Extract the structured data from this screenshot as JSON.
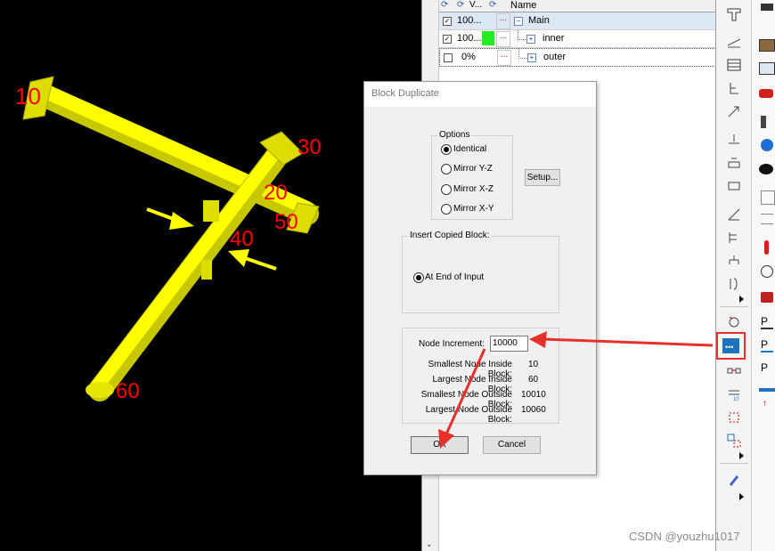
{
  "viewport": {
    "node_labels": [
      "10",
      "20",
      "30",
      "40",
      "50",
      "60"
    ],
    "colors": {
      "pipe": "#ffff00",
      "pipe_shade": "#c8c800",
      "label": "#ff0000",
      "background": "#000000"
    }
  },
  "tree": {
    "header": {
      "col_name": "Name",
      "col_v": "V..."
    },
    "rows": [
      {
        "checked": true,
        "percent": "100...",
        "dots": "...",
        "color": "",
        "name": "Main",
        "expander": "−"
      },
      {
        "checked": true,
        "percent": "100...",
        "dots": "...",
        "color": "#22ee22",
        "name": "inner",
        "expander": "+"
      },
      {
        "checked": false,
        "percent": "0%",
        "dots": "...",
        "color": "",
        "name": "outer",
        "expander": "+"
      }
    ]
  },
  "dialog": {
    "title": "Block Duplicate",
    "options": {
      "label": "Options",
      "items": [
        "Identical",
        "Mirror Y-Z",
        "Mirror X-Z",
        "Mirror X-Y"
      ],
      "selected": "Identical"
    },
    "setup_button": "Setup...",
    "insert": {
      "label": "Insert Copied Block:",
      "option": "At End of Input"
    },
    "node_increment": {
      "label": "Node Increment:",
      "value": "10000"
    },
    "stats": [
      {
        "label": "Smallest Node Inside Block:",
        "value": "10"
      },
      {
        "label": "Largest Node Inside Block:",
        "value": "60"
      },
      {
        "label": "Smallest Node Outside Block:",
        "value": "10010"
      },
      {
        "label": "Largest Node Outside Block:",
        "value": "10060"
      }
    ],
    "ok_button": "OK",
    "cancel_button": "Cancel"
  },
  "watermark": "CSDN @youzhu1017",
  "highlight_color": "#e8302a"
}
